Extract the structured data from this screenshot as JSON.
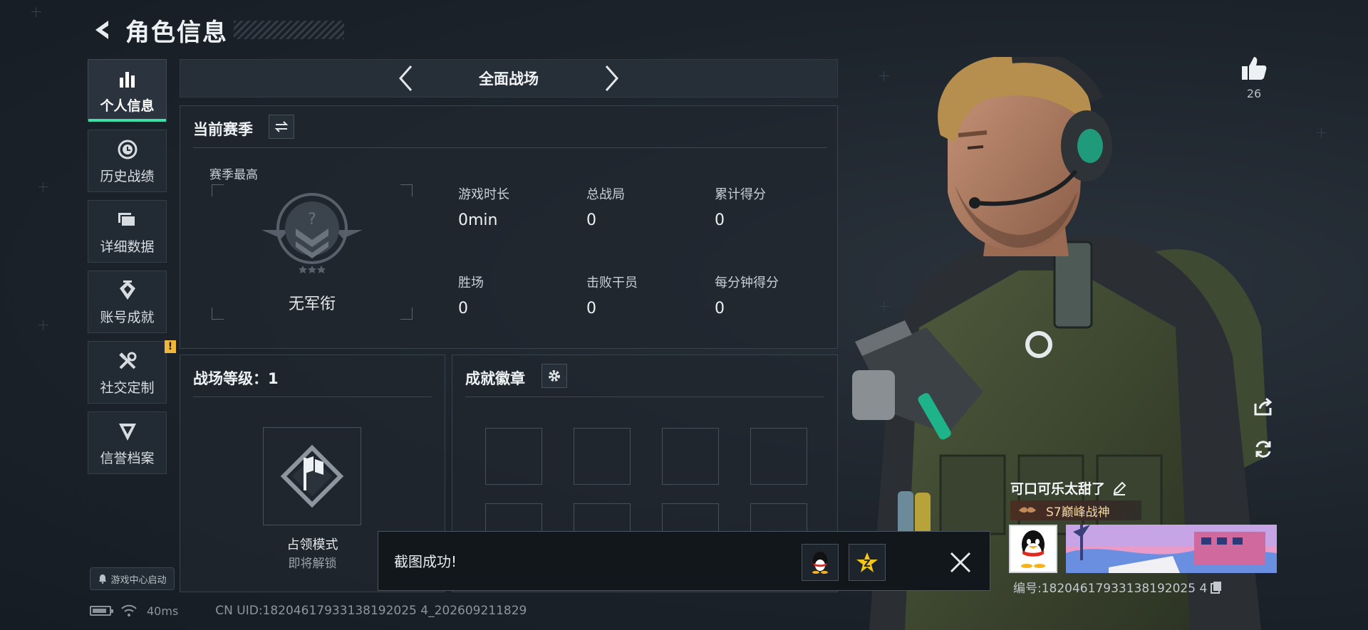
{
  "header": {
    "title": "角色信息",
    "back_icon": "back-arrow-icon"
  },
  "sidebar": {
    "items": [
      {
        "label": "个人信息",
        "icon": "bar-chart-icon",
        "active": true
      },
      {
        "label": "历史战绩",
        "icon": "clock-icon",
        "active": false
      },
      {
        "label": "详细数据",
        "icon": "folder-icon",
        "active": false
      },
      {
        "label": "账号成就",
        "icon": "medal-icon",
        "active": false
      },
      {
        "label": "社交定制",
        "icon": "tools-icon",
        "active": false,
        "badge": "!"
      },
      {
        "label": "信誉档案",
        "icon": "shield-icon",
        "active": false
      }
    ]
  },
  "launch_pill": {
    "label": "游戏中心启动"
  },
  "status_bar": {
    "ping": "40ms",
    "battery_level": 0.85,
    "uid": "CN UID:18204617933138192025 4_202609211829"
  },
  "mode": {
    "title": "全面战场"
  },
  "season": {
    "title": "当前赛季",
    "sub_title": "赛季最高",
    "rank_name": "无军衔",
    "stats": [
      {
        "label": "游戏时长",
        "value": "0min"
      },
      {
        "label": "总战局",
        "value": "0"
      },
      {
        "label": "累计得分",
        "value": "0"
      },
      {
        "label": "胜场",
        "value": "0"
      },
      {
        "label": "击败干员",
        "value": "0"
      },
      {
        "label": "每分钟得分",
        "value": "0"
      }
    ]
  },
  "level": {
    "title": "战场等级：1",
    "mode_name": "占领模式",
    "mode_lock": "即将解锁"
  },
  "badges": {
    "title": "成就徽章"
  },
  "toast": {
    "text": "截图成功!"
  },
  "right": {
    "like_count": "26"
  },
  "profile": {
    "name": "可口可乐太甜了",
    "title": "S7巅峰战神",
    "id": "编号:18204617933138192025 4"
  },
  "colors": {
    "accent": "#3fe0a8",
    "warn": "#f0b838",
    "title_gold": "#f3d7a6"
  }
}
